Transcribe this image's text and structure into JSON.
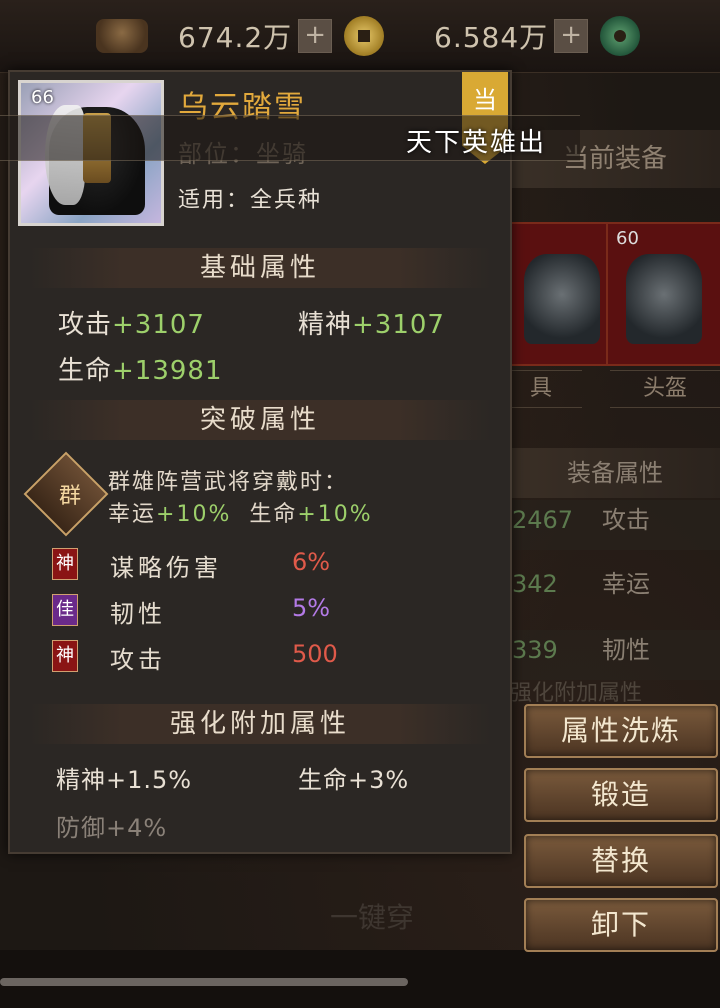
{
  "currency": [
    {
      "value": "674.2万",
      "icon": "copper-coins-icon",
      "plus": "+"
    },
    {
      "value": "6.584万",
      "icon": "gold-coin-icon",
      "plus": "+"
    }
  ],
  "jade_icon": "jade-coin-icon",
  "item": {
    "level": "66",
    "name": "乌云踏雪",
    "part": "部位：坐骑",
    "apply": "适用：全兵种",
    "tag": "当",
    "banner": "天下英雄出"
  },
  "base_attr": {
    "title": "基础属性",
    "stats": [
      {
        "label": "攻击",
        "value": "+3107"
      },
      {
        "label": "精神",
        "value": "+3107"
      },
      {
        "label": "生命",
        "value": "+13981"
      }
    ]
  },
  "breakthrough": {
    "title": "突破属性",
    "faction": "群",
    "line1": "群雄阵营武将穿戴时：",
    "line2": [
      {
        "label": "幸运",
        "value": "+10%"
      },
      {
        "label": "生命",
        "value": "+10%"
      }
    ],
    "rows": [
      {
        "badge": "神",
        "name": "谋略伤害",
        "value": "6%"
      },
      {
        "badge": "佳",
        "name": "韧性",
        "value": "5%"
      },
      {
        "badge": "神",
        "name": "攻击",
        "value": "500"
      }
    ]
  },
  "enhance": {
    "title": "强化附加属性",
    "stats": [
      {
        "text": "精神+1.5%"
      },
      {
        "text": "生命+3%"
      },
      {
        "text": "防御+4%"
      }
    ]
  },
  "current_equip": {
    "title": "当前装备",
    "cards": [
      {
        "level": ""
      },
      {
        "level": "60"
      }
    ],
    "labels": [
      "具",
      "头盔"
    ],
    "attr_title": "装备属性",
    "rows": [
      {
        "value": "2467",
        "name": "攻击"
      },
      {
        "value": "342",
        "name": "幸运"
      },
      {
        "value": "339",
        "name": "韧性"
      }
    ],
    "faded": "强化附加属性"
  },
  "buttons": [
    "属性洗炼",
    "锻造",
    "替换",
    "卸下"
  ],
  "bottom_faded": "一键穿"
}
